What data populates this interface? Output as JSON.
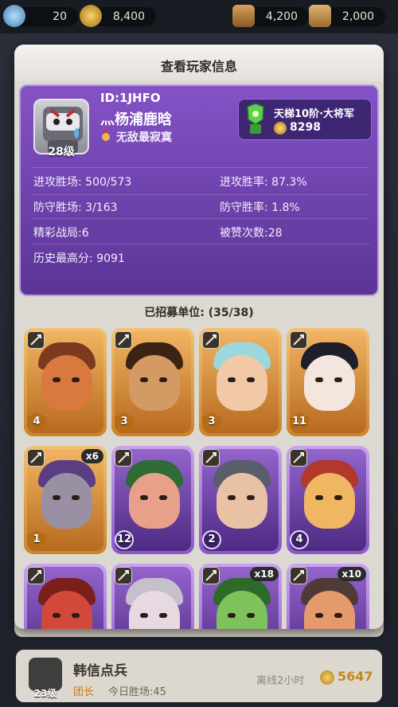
{
  "top_bar": {
    "resources": [
      {
        "icon": "gem-icon",
        "value": "20"
      },
      {
        "icon": "gold-coin-icon",
        "value": "8,400"
      },
      {
        "icon": "lumber-icon",
        "value": "4,200"
      },
      {
        "icon": "scroll-icon",
        "value": "2,000"
      }
    ]
  },
  "modal": {
    "title": "查看玩家信息",
    "player": {
      "avatar_level": "28级",
      "id": "ID:1JHFO",
      "name": "灬杨浦鹿晗",
      "title": "无敌最寂寞"
    },
    "rank": {
      "name": "天梯10阶·大将军",
      "score": "8298"
    },
    "stats": {
      "attack_wins": "进攻胜场: 500/573",
      "attack_rate": "进攻胜率: 87.3%",
      "defense_wins": "防守胜场: 3/163",
      "defense_rate": "防守胜率: 1.8%",
      "highlights": "精彩战局:6",
      "likes": "被赞次数:28",
      "best_score": "历史最高分: 9091"
    },
    "units_label": "已招募单位: (35/38)",
    "units": [
      {
        "rarity": "orange",
        "type_icon": "crossed-swords-icon",
        "level": "4",
        "count": "",
        "skin": "#d8793f",
        "hair": "#7b3a1e"
      },
      {
        "rarity": "orange",
        "type_icon": "sword-icon",
        "level": "3",
        "count": "",
        "skin": "#d49a63",
        "hair": "#3a2414"
      },
      {
        "rarity": "orange",
        "type_icon": "sword-icon",
        "level": "3",
        "count": "",
        "skin": "#f2c9a6",
        "hair": "#9ad8dd"
      },
      {
        "rarity": "orange",
        "type_icon": "sword-icon",
        "level": "11",
        "count": "",
        "skin": "#f4e6de",
        "hair": "#1f1f2a"
      },
      {
        "rarity": "orange",
        "type_icon": "sword-icon",
        "level": "1",
        "count": "x6",
        "skin": "#9a90a4",
        "hair": "#5a3d82"
      },
      {
        "rarity": "purple",
        "type_icon": "sword-icon",
        "level": "12",
        "count": "",
        "skin": "#e7a08a",
        "hair": "#2f6b34"
      },
      {
        "rarity": "purple",
        "type_icon": "crossed-swords-icon",
        "level": "2",
        "count": "",
        "skin": "#e9c1a5",
        "hair": "#585e6b"
      },
      {
        "rarity": "purple",
        "type_icon": "sword-icon",
        "level": "4",
        "count": "",
        "skin": "#f0b763",
        "hair": "#b2382c"
      },
      {
        "rarity": "purple",
        "type_icon": "sword-icon",
        "level": "",
        "count": "",
        "skin": "#d2493b",
        "hair": "#7a1f1a"
      },
      {
        "rarity": "purple",
        "type_icon": "magnifier-icon",
        "level": "",
        "count": "",
        "skin": "#e8d8e2",
        "hair": "#c5c0cb"
      },
      {
        "rarity": "purple",
        "type_icon": "sword-icon",
        "level": "",
        "count": "x18",
        "skin": "#7dc25a",
        "hair": "#2e6a2a"
      },
      {
        "rarity": "purple",
        "type_icon": "sword-icon",
        "level": "",
        "count": "x10",
        "skin": "#e49a6c",
        "hair": "#4f3b36"
      }
    ]
  },
  "background": {
    "row": {
      "avatar_level": "23级",
      "name": "韩信点兵",
      "role": "团长",
      "wins": "今日胜场:45",
      "status": "离线2小时",
      "score": "5647"
    }
  }
}
